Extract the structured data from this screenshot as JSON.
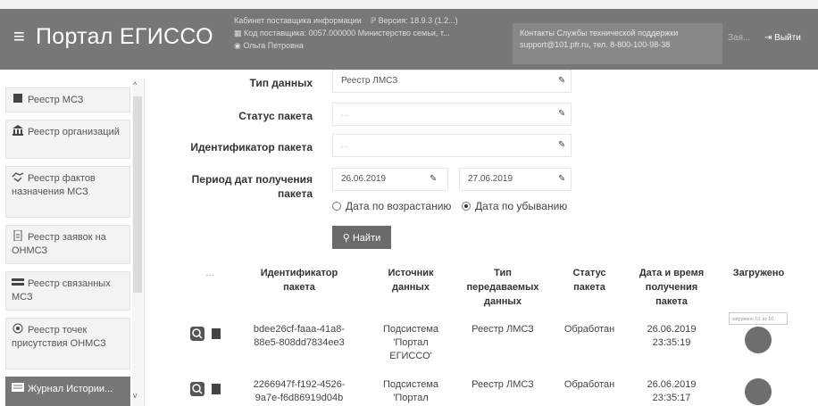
{
  "topstrip_text": "",
  "header": {
    "brand": "Портал ЕГИССО",
    "cabinet": "Кабинет поставщика информации",
    "version_label": "Версия:",
    "version": "18.9.3 (1.2...)",
    "supplier_code_label": "Код поставщика:",
    "supplier_code": "0057.000000 Министерство семьи, т...",
    "user": "Ольга Петровна",
    "support_line1": "Контакты Службы технической поддержки",
    "support_line2": "support@101.pfr.ru, тел. 8-800-100-98-38",
    "help_link": "Зая...",
    "logout": "Выйти"
  },
  "sidebar": {
    "items": [
      {
        "label": "Реестр МСЗ"
      },
      {
        "label": "Реестр организаций"
      },
      {
        "label": "Реестр фактов назначения МСЗ"
      },
      {
        "label": "Реестр заявок на ОНМСЗ"
      },
      {
        "label": "Реестр связанных МСЗ"
      },
      {
        "label": "Реестр точек присутствия ОНМСЗ"
      },
      {
        "label": "Журнал Истории..."
      }
    ]
  },
  "filters": {
    "data_type_label": "Тип данных",
    "data_type_value": "Реестр ЛМСЗ",
    "status_label": "Статус пакета",
    "status_placeholder": "...",
    "id_label": "Идентификатор пакета",
    "id_placeholder": "...",
    "period_label": "Период дат получения пакета",
    "date_from": "26.06.2019",
    "date_to": "27.06.2019",
    "sort_asc": "Дата по возрастанию",
    "sort_desc": "Дата по убыванию",
    "sort_selected": "desc",
    "search_button": "Найти"
  },
  "table": {
    "headers": {
      "actions": "...",
      "id": "Идентификатор пакета",
      "source": "Источник данных",
      "type": "Тип передаваемых данных",
      "status": "Статус пакета",
      "datetime": "Дата и время получения пакета",
      "loaded": "Загружено"
    },
    "rows": [
      {
        "id": "bdee26cf-faaa-41a8-88e5-808dd7834ee3",
        "source": "Подсистема 'Портал ЕГИССО'",
        "type": "Реестр ЛМСЗ",
        "status": "Обработан",
        "date": "26.06.2019",
        "time": "23:35:19"
      },
      {
        "id": "2266947f-f192-4526-9a7e-f6d86919d04b",
        "source": "Подсистема 'Портал",
        "type": "Реестр ЛМСЗ",
        "status": "Обработан",
        "date": "26.06.2019",
        "time": "23:35:17"
      }
    ],
    "tooltip": "загружено 1/1 из 1/1"
  }
}
